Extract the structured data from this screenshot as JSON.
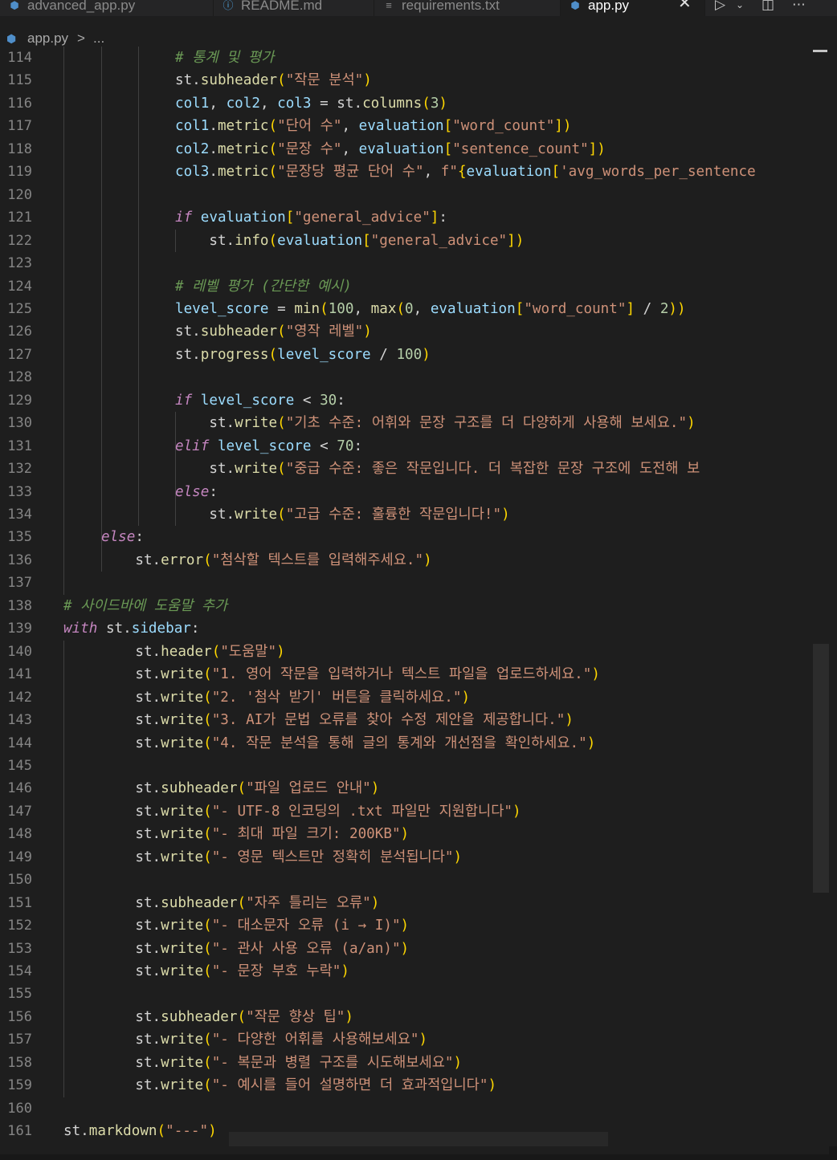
{
  "tabs": [
    {
      "icon": "python-icon",
      "label": "advanced_app.py",
      "active": false
    },
    {
      "icon": "info-icon",
      "label": "README.md",
      "active": false
    },
    {
      "icon": "lines-icon",
      "label": "requirements.txt",
      "active": false
    },
    {
      "icon": "python-icon",
      "label": "app.py",
      "active": true
    }
  ],
  "breadcrumb": {
    "file": "app.py",
    "separator": ">",
    "more": "..."
  },
  "editor": {
    "first_line_number": 114,
    "lines": [
      {
        "n": "114",
        "tokens": [
          [
            "cm",
            "# 통계 및 평가"
          ]
        ]
      },
      {
        "n": "115",
        "tokens": [
          [
            "op",
            "st."
          ],
          [
            "fn",
            "subheader"
          ],
          [
            "pn",
            "("
          ],
          [
            "str",
            "\"작문 분석\""
          ],
          [
            "pn",
            ")"
          ]
        ]
      },
      {
        "n": "116",
        "tokens": [
          [
            "var",
            "col1"
          ],
          [
            "op",
            ", "
          ],
          [
            "var",
            "col2"
          ],
          [
            "op",
            ", "
          ],
          [
            "var",
            "col3"
          ],
          [
            "op",
            " = st."
          ],
          [
            "fn",
            "columns"
          ],
          [
            "pn",
            "("
          ],
          [
            "num",
            "3"
          ],
          [
            "pn",
            ")"
          ]
        ]
      },
      {
        "n": "117",
        "tokens": [
          [
            "var",
            "col1"
          ],
          [
            "op",
            "."
          ],
          [
            "fn",
            "metric"
          ],
          [
            "pn",
            "("
          ],
          [
            "str",
            "\"단어 수\""
          ],
          [
            "op",
            ", "
          ],
          [
            "var",
            "evaluation"
          ],
          [
            "pn",
            "["
          ],
          [
            "str",
            "\"word_count\""
          ],
          [
            "pn",
            "])"
          ]
        ]
      },
      {
        "n": "118",
        "tokens": [
          [
            "var",
            "col2"
          ],
          [
            "op",
            "."
          ],
          [
            "fn",
            "metric"
          ],
          [
            "pn",
            "("
          ],
          [
            "str",
            "\"문장 수\""
          ],
          [
            "op",
            ", "
          ],
          [
            "var",
            "evaluation"
          ],
          [
            "pn",
            "["
          ],
          [
            "str",
            "\"sentence_count\""
          ],
          [
            "pn",
            "])"
          ]
        ]
      },
      {
        "n": "119",
        "tokens": [
          [
            "var",
            "col3"
          ],
          [
            "op",
            "."
          ],
          [
            "fn",
            "metric"
          ],
          [
            "pn",
            "("
          ],
          [
            "str",
            "\"문장당 평균 단어 수\""
          ],
          [
            "op",
            ", "
          ],
          [
            "str",
            "f\""
          ],
          [
            "pn",
            "{"
          ],
          [
            "var",
            "evaluation"
          ],
          [
            "pn",
            "["
          ],
          [
            "str",
            "'avg_words_per_sentence"
          ]
        ]
      },
      {
        "n": "120",
        "tokens": []
      },
      {
        "n": "121",
        "tokens": [
          [
            "kw",
            "if"
          ],
          [
            "op",
            " "
          ],
          [
            "var",
            "evaluation"
          ],
          [
            "pn",
            "["
          ],
          [
            "str",
            "\"general_advice\""
          ],
          [
            "pn",
            "]"
          ],
          [
            "op",
            ":"
          ]
        ]
      },
      {
        "n": "122",
        "tokens": [
          [
            "op",
            "    st."
          ],
          [
            "fn",
            "info"
          ],
          [
            "pn",
            "("
          ],
          [
            "var",
            "evaluation"
          ],
          [
            "pn",
            "["
          ],
          [
            "str",
            "\"general_advice\""
          ],
          [
            "pn",
            "])"
          ]
        ]
      },
      {
        "n": "123",
        "tokens": []
      },
      {
        "n": "124",
        "tokens": [
          [
            "cm",
            "# 레벨 평가 (간단한 예시)"
          ]
        ]
      },
      {
        "n": "125",
        "tokens": [
          [
            "var",
            "level_score"
          ],
          [
            "op",
            " = "
          ],
          [
            "fn",
            "min"
          ],
          [
            "pn",
            "("
          ],
          [
            "num",
            "100"
          ],
          [
            "op",
            ", "
          ],
          [
            "fn",
            "max"
          ],
          [
            "pn",
            "("
          ],
          [
            "num",
            "0"
          ],
          [
            "op",
            ", "
          ],
          [
            "var",
            "evaluation"
          ],
          [
            "pn",
            "["
          ],
          [
            "str",
            "\"word_count\""
          ],
          [
            "pn",
            "]"
          ],
          [
            "op",
            " / "
          ],
          [
            "num",
            "2"
          ],
          [
            "pn",
            "))"
          ]
        ]
      },
      {
        "n": "126",
        "tokens": [
          [
            "op",
            "st."
          ],
          [
            "fn",
            "subheader"
          ],
          [
            "pn",
            "("
          ],
          [
            "str",
            "\"영작 레벨\""
          ],
          [
            "pn",
            ")"
          ]
        ]
      },
      {
        "n": "127",
        "tokens": [
          [
            "op",
            "st."
          ],
          [
            "fn",
            "progress"
          ],
          [
            "pn",
            "("
          ],
          [
            "var",
            "level_score"
          ],
          [
            "op",
            " / "
          ],
          [
            "num",
            "100"
          ],
          [
            "pn",
            ")"
          ]
        ]
      },
      {
        "n": "128",
        "tokens": []
      },
      {
        "n": "129",
        "tokens": [
          [
            "kw",
            "if"
          ],
          [
            "op",
            " "
          ],
          [
            "var",
            "level_score"
          ],
          [
            "op",
            " < "
          ],
          [
            "num",
            "30"
          ],
          [
            "op",
            ":"
          ]
        ]
      },
      {
        "n": "130",
        "tokens": [
          [
            "op",
            "    st."
          ],
          [
            "fn",
            "write"
          ],
          [
            "pn",
            "("
          ],
          [
            "str",
            "\"기초 수준: 어휘와 문장 구조를 더 다양하게 사용해 보세요.\""
          ],
          [
            "pn",
            ")"
          ]
        ]
      },
      {
        "n": "131",
        "tokens": [
          [
            "kw",
            "elif"
          ],
          [
            "op",
            " "
          ],
          [
            "var",
            "level_score"
          ],
          [
            "op",
            " < "
          ],
          [
            "num",
            "70"
          ],
          [
            "op",
            ":"
          ]
        ]
      },
      {
        "n": "132",
        "tokens": [
          [
            "op",
            "    st."
          ],
          [
            "fn",
            "write"
          ],
          [
            "pn",
            "("
          ],
          [
            "str",
            "\"중급 수준: 좋은 작문입니다. 더 복잡한 문장 구조에 도전해 보"
          ]
        ]
      },
      {
        "n": "133",
        "tokens": [
          [
            "kw",
            "else"
          ],
          [
            "op",
            ":"
          ]
        ]
      },
      {
        "n": "134",
        "tokens": [
          [
            "op",
            "    st."
          ],
          [
            "fn",
            "write"
          ],
          [
            "pn",
            "("
          ],
          [
            "str",
            "\"고급 수준: 훌륭한 작문입니다!\""
          ],
          [
            "pn",
            ")"
          ]
        ]
      },
      {
        "n": "135",
        "tokens": [
          [
            "kw",
            "else"
          ],
          [
            "op",
            ":"
          ]
        ]
      },
      {
        "n": "136",
        "tokens": [
          [
            "op",
            "    st."
          ],
          [
            "fn",
            "error"
          ],
          [
            "pn",
            "("
          ],
          [
            "str",
            "\"첨삭할 텍스트를 입력해주세요.\""
          ],
          [
            "pn",
            ")"
          ]
        ]
      },
      {
        "n": "137",
        "tokens": []
      },
      {
        "n": "138",
        "tokens": [
          [
            "cm",
            "# 사이드바에 도움말 추가"
          ]
        ]
      },
      {
        "n": "139",
        "tokens": [
          [
            "kw",
            "with"
          ],
          [
            "op",
            " st."
          ],
          [
            "var",
            "sidebar"
          ],
          [
            "op",
            ":"
          ]
        ]
      },
      {
        "n": "140",
        "tokens": [
          [
            "op",
            "    st."
          ],
          [
            "fn",
            "header"
          ],
          [
            "pn",
            "("
          ],
          [
            "str",
            "\"도움말\""
          ],
          [
            "pn",
            ")"
          ]
        ]
      },
      {
        "n": "141",
        "tokens": [
          [
            "op",
            "    st."
          ],
          [
            "fn",
            "write"
          ],
          [
            "pn",
            "("
          ],
          [
            "str",
            "\"1. 영어 작문을 입력하거나 텍스트 파일을 업로드하세요.\""
          ],
          [
            "pn",
            ")"
          ]
        ]
      },
      {
        "n": "142",
        "tokens": [
          [
            "op",
            "    st."
          ],
          [
            "fn",
            "write"
          ],
          [
            "pn",
            "("
          ],
          [
            "str",
            "\"2. '첨삭 받기' 버튼을 클릭하세요.\""
          ],
          [
            "pn",
            ")"
          ]
        ]
      },
      {
        "n": "143",
        "tokens": [
          [
            "op",
            "    st."
          ],
          [
            "fn",
            "write"
          ],
          [
            "pn",
            "("
          ],
          [
            "str",
            "\"3. AI가 문법 오류를 찾아 수정 제안을 제공합니다.\""
          ],
          [
            "pn",
            ")"
          ]
        ]
      },
      {
        "n": "144",
        "tokens": [
          [
            "op",
            "    st."
          ],
          [
            "fn",
            "write"
          ],
          [
            "pn",
            "("
          ],
          [
            "str",
            "\"4. 작문 분석을 통해 글의 통계와 개선점을 확인하세요.\""
          ],
          [
            "pn",
            ")"
          ]
        ]
      },
      {
        "n": "145",
        "tokens": []
      },
      {
        "n": "146",
        "tokens": [
          [
            "op",
            "    st."
          ],
          [
            "fn",
            "subheader"
          ],
          [
            "pn",
            "("
          ],
          [
            "str",
            "\"파일 업로드 안내\""
          ],
          [
            "pn",
            ")"
          ]
        ]
      },
      {
        "n": "147",
        "tokens": [
          [
            "op",
            "    st."
          ],
          [
            "fn",
            "write"
          ],
          [
            "pn",
            "("
          ],
          [
            "str",
            "\"- UTF-8 인코딩의 .txt 파일만 지원합니다\""
          ],
          [
            "pn",
            ")"
          ]
        ]
      },
      {
        "n": "148",
        "tokens": [
          [
            "op",
            "    st."
          ],
          [
            "fn",
            "write"
          ],
          [
            "pn",
            "("
          ],
          [
            "str",
            "\"- 최대 파일 크기: 200KB\""
          ],
          [
            "pn",
            ")"
          ]
        ]
      },
      {
        "n": "149",
        "tokens": [
          [
            "op",
            "    st."
          ],
          [
            "fn",
            "write"
          ],
          [
            "pn",
            "("
          ],
          [
            "str",
            "\"- 영문 텍스트만 정확히 분석됩니다\""
          ],
          [
            "pn",
            ")"
          ]
        ]
      },
      {
        "n": "150",
        "tokens": []
      },
      {
        "n": "151",
        "tokens": [
          [
            "op",
            "    st."
          ],
          [
            "fn",
            "subheader"
          ],
          [
            "pn",
            "("
          ],
          [
            "str",
            "\"자주 틀리는 오류\""
          ],
          [
            "pn",
            ")"
          ]
        ]
      },
      {
        "n": "152",
        "tokens": [
          [
            "op",
            "    st."
          ],
          [
            "fn",
            "write"
          ],
          [
            "pn",
            "("
          ],
          [
            "str",
            "\"- 대소문자 오류 (i → I)\""
          ],
          [
            "pn",
            ")"
          ]
        ]
      },
      {
        "n": "153",
        "tokens": [
          [
            "op",
            "    st."
          ],
          [
            "fn",
            "write"
          ],
          [
            "pn",
            "("
          ],
          [
            "str",
            "\"- 관사 사용 오류 (a/an)\""
          ],
          [
            "pn",
            ")"
          ]
        ]
      },
      {
        "n": "154",
        "tokens": [
          [
            "op",
            "    st."
          ],
          [
            "fn",
            "write"
          ],
          [
            "pn",
            "("
          ],
          [
            "str",
            "\"- 문장 부호 누락\""
          ],
          [
            "pn",
            ")"
          ]
        ]
      },
      {
        "n": "155",
        "tokens": []
      },
      {
        "n": "156",
        "tokens": [
          [
            "op",
            "    st."
          ],
          [
            "fn",
            "subheader"
          ],
          [
            "pn",
            "("
          ],
          [
            "str",
            "\"작문 향상 팁\""
          ],
          [
            "pn",
            ")"
          ]
        ]
      },
      {
        "n": "157",
        "tokens": [
          [
            "op",
            "    st."
          ],
          [
            "fn",
            "write"
          ],
          [
            "pn",
            "("
          ],
          [
            "str",
            "\"- 다양한 어휘를 사용해보세요\""
          ],
          [
            "pn",
            ")"
          ]
        ]
      },
      {
        "n": "158",
        "tokens": [
          [
            "op",
            "    st."
          ],
          [
            "fn",
            "write"
          ],
          [
            "pn",
            "("
          ],
          [
            "str",
            "\"- 복문과 병렬 구조를 시도해보세요\""
          ],
          [
            "pn",
            ")"
          ]
        ]
      },
      {
        "n": "159",
        "tokens": [
          [
            "op",
            "    st."
          ],
          [
            "fn",
            "write"
          ],
          [
            "pn",
            "("
          ],
          [
            "str",
            "\"- 예시를 들어 설명하면 더 효과적입니다\""
          ],
          [
            "pn",
            ")"
          ]
        ]
      },
      {
        "n": "160",
        "tokens": []
      },
      {
        "n": "161",
        "tokens": [
          [
            "op",
            "st."
          ],
          [
            "fn",
            "markdown"
          ],
          [
            "pn",
            "("
          ],
          [
            "str",
            "\"---\""
          ],
          [
            "pn",
            ")"
          ]
        ]
      }
    ]
  },
  "colors": {
    "background": "#1e1e1e",
    "keyword": "#c586c0",
    "comment": "#6a9955",
    "function": "#dcdcaa",
    "variable": "#9cdcfe",
    "string": "#ce9178",
    "number": "#b5cea8",
    "bracket": "#ffd700"
  }
}
